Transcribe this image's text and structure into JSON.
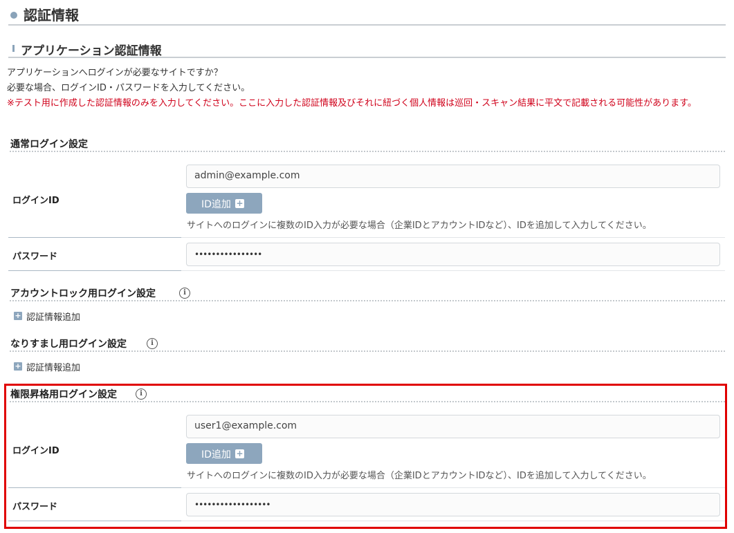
{
  "page_title": "認証情報",
  "section_title": "アプリケーション認証情報",
  "description": {
    "line1": "アプリケーションへログインが必要なサイトですか？",
    "line2": "必要な場合、ログインID・パスワードを入力してください。",
    "warning": "※テスト用に作成した認証情報のみを入力してください。ここに入力した認証情報及びそれに紐づく個人情報は巡回・スキャン結果に平文で記載される可能性があります。"
  },
  "normal_login": {
    "heading": "通常ログイン設定",
    "login_id_label": "ログインID",
    "login_id_value": "admin@example.com",
    "add_id_button": "ID追加",
    "add_id_hint": "サイトへのログインに複数のID入力が必要な場合（企業IDとアカウントIDなど）、IDを追加して入力してください。",
    "password_label": "パスワード",
    "password_value": "••••••••••••••••"
  },
  "account_lock": {
    "heading": "アカウントロック用ログイン設定",
    "info_icon": "i",
    "add_label": "認証情報追加"
  },
  "impersonation": {
    "heading": "なりすまし用ログイン設定",
    "info_icon": "i",
    "add_label": "認証情報追加"
  },
  "privilege": {
    "heading": "権限昇格用ログイン設定",
    "info_icon": "i",
    "login_id_label": "ログインID",
    "login_id_value": "user1@example.com",
    "add_id_button": "ID追加",
    "add_id_hint": "サイトへのログインに複数のID入力が必要な場合（企業IDとアカウントIDなど）、IDを追加して入力してください。",
    "password_label": "パスワード",
    "password_value": "••••••••••••••••••"
  },
  "icons": {
    "plus": "+"
  },
  "colors": {
    "highlight": "#e00000",
    "warning": "#d0021b",
    "accent": "#8da6bd"
  }
}
